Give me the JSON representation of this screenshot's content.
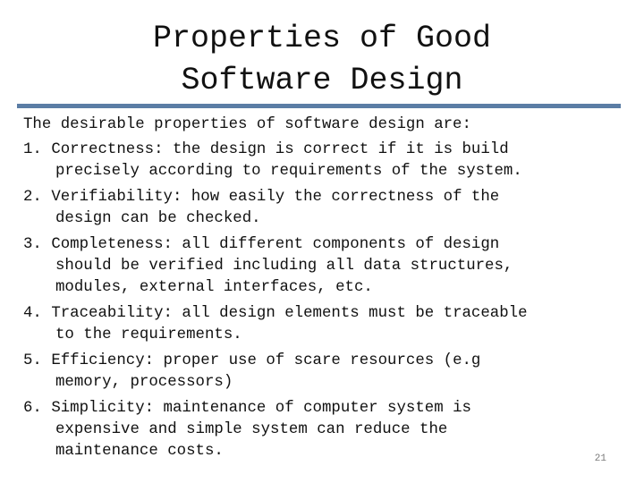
{
  "slide": {
    "title_lines": [
      "Properties of Good",
      "Software Design"
    ],
    "intro": "The desirable properties of software design are:",
    "items": [
      {
        "number": "1. ",
        "lines": [
          "Correctness: the design is correct if it is build",
          "precisely according to requirements of the system."
        ]
      },
      {
        "number": "2. ",
        "lines": [
          "Verifiability: how easily the correctness of the",
          "design can be checked."
        ]
      },
      {
        "number": "3. ",
        "lines": [
          "Completeness: all different components of design",
          "should be verified including all data structures,",
          "modules, external interfaces, etc."
        ]
      },
      {
        "number": "4. ",
        "lines": [
          "Traceability: all design elements must be traceable",
          "to the requirements."
        ]
      },
      {
        "number": "5. ",
        "lines": [
          "Efficiency: proper use of scare resources (e.g",
          "memory, processors)"
        ]
      },
      {
        "number": "6. ",
        "lines": [
          "Simplicity: maintenance of computer system is",
          "expensive and simple system can reduce the",
          "maintenance costs."
        ]
      }
    ],
    "page_number": "21",
    "accent_color": "#5b7da5"
  }
}
